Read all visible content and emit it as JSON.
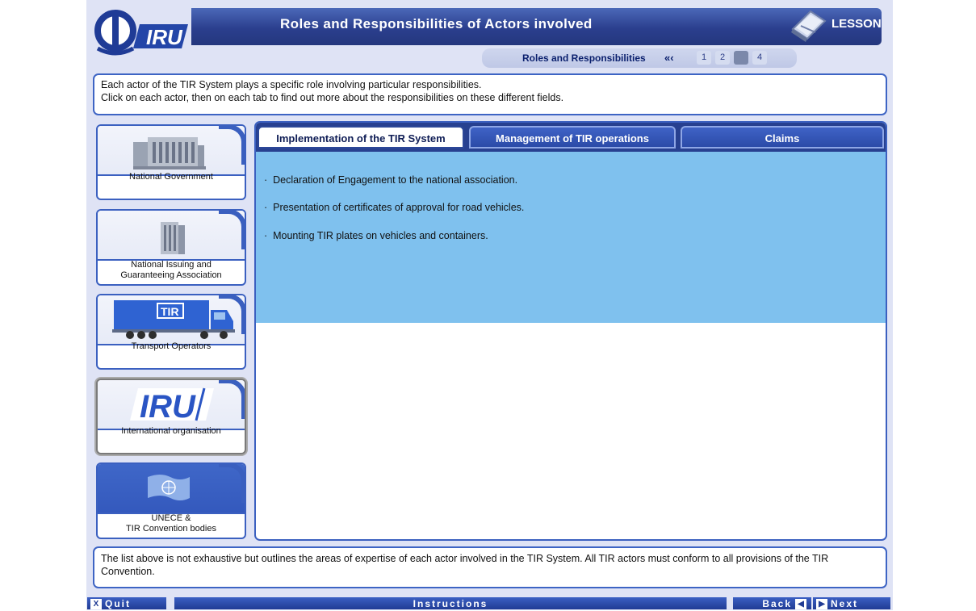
{
  "header": {
    "logo_text": "IRU",
    "title": "Roles and Responsibilities of Actors involved",
    "lesson_label": "LESSON"
  },
  "subnav": {
    "section_label": "Roles and Responsibilities",
    "back_arrows": "«‹",
    "pages": [
      "1",
      "2",
      "3",
      "4"
    ],
    "current_page": "3"
  },
  "intro": {
    "line1": "Each actor of the TIR System plays a specific role involving particular responsibilities.",
    "line2": "Click on each actor, then on each tab to find out more about the responsibilities on these different fields."
  },
  "actors": [
    {
      "label": "National Government",
      "icon": "government-building-icon"
    },
    {
      "label1": "National Issuing and",
      "label2": "Guaranteeing Association",
      "icon": "office-tower-icon"
    },
    {
      "label": "Transport Operators",
      "icon": "tir-truck-icon",
      "truck_text": "TIR"
    },
    {
      "label": "International organisation",
      "icon": "iru-logo-icon",
      "logo_text": "IRU",
      "selected": true
    },
    {
      "label1": "UNECE &",
      "label2": "TIR Convention bodies",
      "icon": "un-flag-icon"
    }
  ],
  "tabs": [
    {
      "label": "Implementation of the TIR System",
      "active": true
    },
    {
      "label": "Management of TIR operations",
      "active": false
    },
    {
      "label": "Claims",
      "active": false
    }
  ],
  "content": {
    "bullets": [
      "Declaration of Engagement to the national association.",
      "Presentation of certificates of approval for road vehicles.",
      "Mounting TIR plates on vehicles and containers."
    ]
  },
  "footer_note": {
    "text": "The list above is not exhaustive but outlines the areas of expertise of each actor involved in the TIR System. All TIR actors must conform to all provisions of the TIR Convention."
  },
  "navbar": {
    "quit_icon": "X",
    "quit_label": "Quit",
    "instructions_label": "Instructions",
    "back_label": "Back",
    "back_icon": "◀",
    "next_icon": "▶",
    "next_label": "Next"
  },
  "colors": {
    "accent_blue": "#3b60c0",
    "header_blue": "#2b3f8e",
    "content_blue": "#7fc1ee",
    "background": "#dfe3f5"
  }
}
